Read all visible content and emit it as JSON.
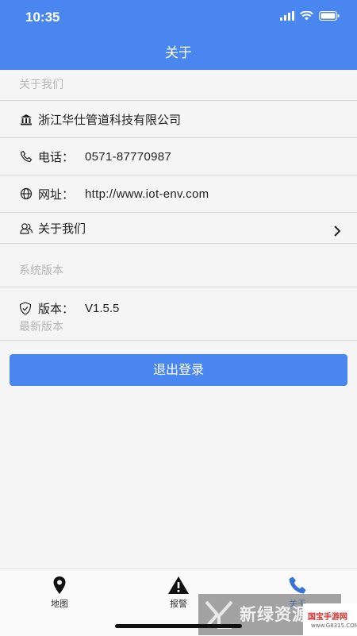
{
  "status_bar": {
    "time": "10:35"
  },
  "header": {
    "title": "关于"
  },
  "about_section": {
    "header": "关于我们",
    "company": "浙江华仕管道科技有限公司",
    "phone_label": "电话：",
    "phone_value": "0571-87770987",
    "website_label": "网址：",
    "website_value": "http://www.iot-env.com",
    "about_us_link": "关于我们"
  },
  "version_section": {
    "header": "系统版本",
    "version_label": "版本：",
    "version_value": "V1.5.5",
    "latest_text": "最新版本"
  },
  "logout_button": "退出登录",
  "tabs": [
    {
      "label": "地图",
      "icon": "map-pin-icon"
    },
    {
      "label": "报警",
      "icon": "warning-icon"
    },
    {
      "label": "关于",
      "icon": "phone-icon"
    }
  ],
  "watermark": {
    "text": "新绿资源网",
    "text2": "国宝手游网",
    "url": "www.G8315.COM"
  },
  "colors": {
    "accent": "#4a86f0",
    "background": "#f5f5f5"
  }
}
